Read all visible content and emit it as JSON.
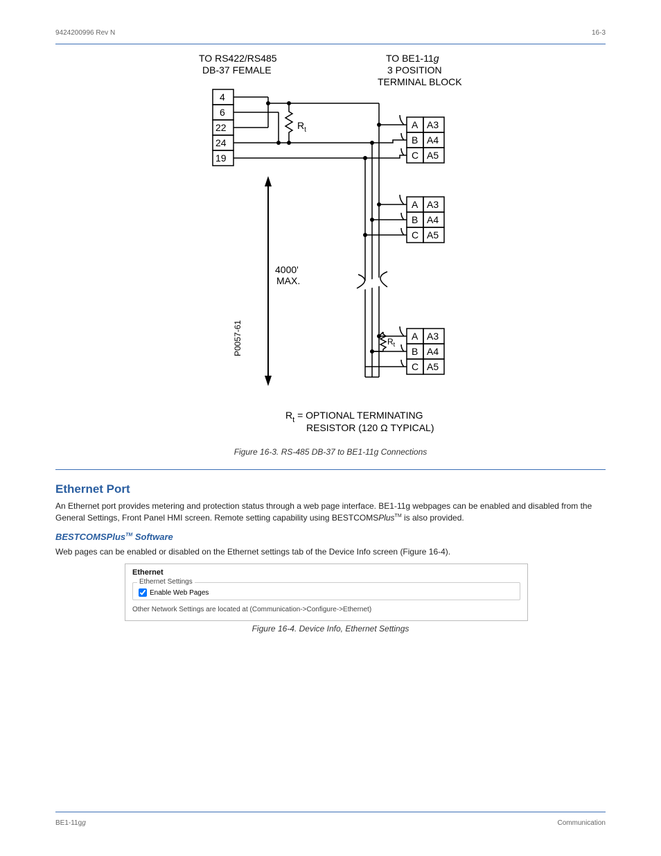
{
  "header": {
    "left": "9424200996 Rev N",
    "right": "16-3"
  },
  "diagram": {
    "left_title_line1": "TO RS422/RS485",
    "left_title_line2": "DB-37  FEMALE",
    "right_title_line1": "TO BE1-11",
    "right_title_line1_italic": "g",
    "right_title_line2": "3 POSITION",
    "right_title_line3": "TERMINAL BLOCK",
    "pins": [
      "4",
      "6",
      "22",
      "24",
      "19"
    ],
    "rt_label": "R",
    "rt_sub": "t",
    "distance_line1": "4000'",
    "distance_line2": "MAX.",
    "side_code": "P0057-61",
    "term_rows": [
      {
        "c1": "A",
        "c2": "A3"
      },
      {
        "c1": "B",
        "c2": "A4"
      },
      {
        "c1": "C",
        "c2": "A5"
      }
    ],
    "footer_note_a": "R",
    "footer_note_a_sub": "t",
    "footer_note_b": "= OPTIONAL TERMINATING",
    "footer_note_c": "RESISTOR (120 ",
    "footer_note_omega": "Ω",
    "footer_note_d": " TYPICAL)"
  },
  "figure_caption": "Figure 16-3. RS-485 DB-37 to BE1-11g Connections",
  "section": {
    "title": "Ethernet Port",
    "para1": "An Ethernet port provides metering and protection status through a web page interface. BE1-11g webpages can be enabled and disabled from the General Settings, Front Panel HMI screen. Remote setting capability using BESTCOMS",
    "para1_tm": "Plus",
    "para1_suffix": " is also provided.",
    "subhead": "BESTCOMS",
    "subhead_tm": "Plus",
    "subhead_suffix": " Software",
    "para2": "Web pages can be enabled or disabled on the Ethernet settings tab of the Device Info screen (Figure 16-4).",
    "screenshot": {
      "title": "Ethernet",
      "fieldset_legend": "Ethernet Settings",
      "checkbox_label": "Enable Web Pages",
      "checkbox_checked": true,
      "note": "Other Network Settings are located at (Communication->Configure->Ethernet)"
    },
    "figure_caption2": "Figure 16-4. Device Info, Ethernet Settings"
  },
  "footer": {
    "left": "BE1-11g",
    "right": "Communication"
  }
}
